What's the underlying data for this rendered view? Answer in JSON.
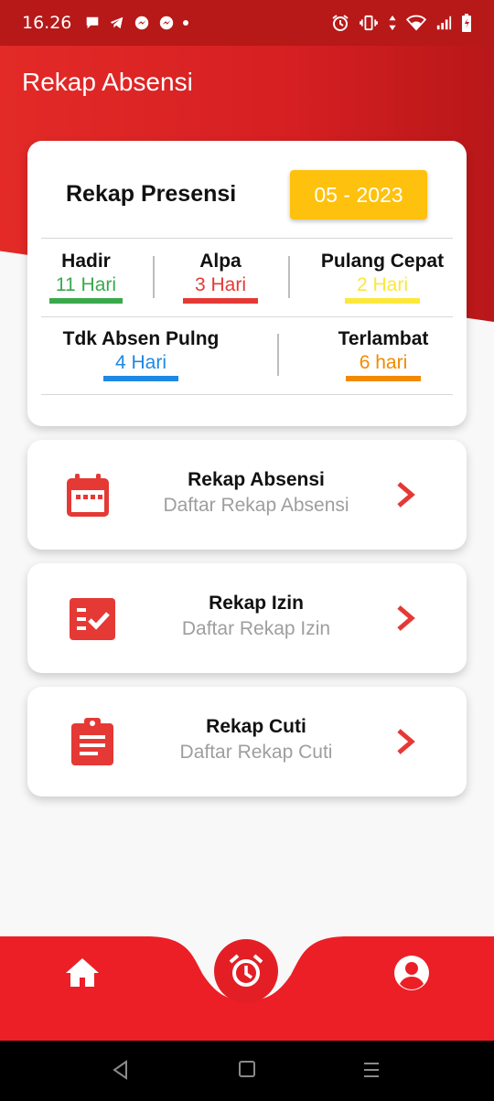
{
  "status_bar": {
    "time": "16.26",
    "left_icons": [
      "chat-icon",
      "telegram-icon",
      "messenger-icon",
      "messenger-icon",
      "dot-icon"
    ],
    "right_icons": [
      "alarm-icon",
      "vibrate-icon",
      "data-arrows-icon",
      "wifi-icon",
      "signal-icon",
      "battery-icon"
    ]
  },
  "header": {
    "title": "Rekap Absensi"
  },
  "summary": {
    "title": "Rekap Presensi",
    "period": "05 - 2023",
    "stats": [
      {
        "label": "Hadir",
        "value": "11 Hari",
        "color": "#3aa94c"
      },
      {
        "label": "Alpa",
        "value": "3 Hari",
        "color": "#e53935"
      },
      {
        "label": "Pulang Cepat",
        "value": "2 Hari",
        "color": "#fbe83b"
      },
      {
        "label": "Tdk Absen Pulng",
        "value": "4 Hari",
        "color": "#1e88e5"
      },
      {
        "label": "Terlambat",
        "value": "6 hari",
        "color": "#f28a00"
      }
    ]
  },
  "menu": [
    {
      "title": "Rekap Absensi",
      "subtitle": "Daftar Rekap Absensi",
      "icon": "calendar-icon"
    },
    {
      "title": "Rekap Izin",
      "subtitle": "Daftar Rekap Izin",
      "icon": "checklist-icon"
    },
    {
      "title": "Rekap Cuti",
      "subtitle": "Daftar Rekap Cuti",
      "icon": "clipboard-icon"
    }
  ],
  "bottom_nav": {
    "items": [
      "home-icon",
      "alarm-clock-icon",
      "profile-icon"
    ],
    "color": "#ec1f26"
  },
  "colors": {
    "accent": "#e31f25",
    "period_button": "#fec10d"
  }
}
